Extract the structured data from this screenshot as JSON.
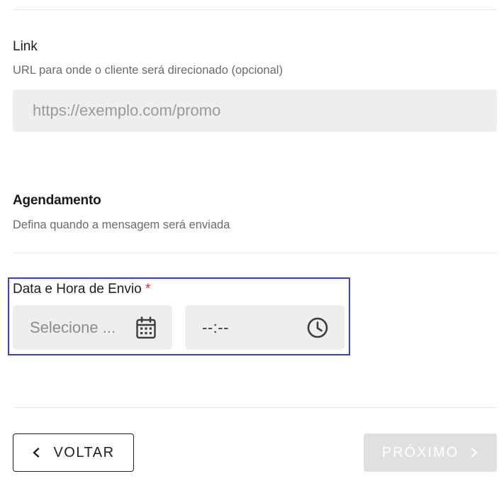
{
  "link_section": {
    "label": "Link",
    "hint": "URL para onde o cliente será direcionado (opcional)",
    "placeholder": "https://exemplo.com/promo",
    "value": ""
  },
  "schedule_section": {
    "title": "Agendamento",
    "hint": "Defina quando a mensagem será enviada",
    "field_label": "Data e Hora de Envio",
    "required_mark": "*",
    "date_placeholder": "Selecione ...",
    "time_placeholder": "--:--"
  },
  "footer": {
    "back_label": "VOLTAR",
    "next_label": "PRÓXIMO"
  },
  "colors": {
    "focus_border": "#3a3fc6",
    "required": "#d32f2f",
    "disabled_button": "#e0e0e0"
  },
  "icons": {
    "date_picker": "calendar-icon",
    "time_picker": "clock-icon",
    "back": "chevron-left-icon",
    "next": "chevron-right-icon"
  }
}
